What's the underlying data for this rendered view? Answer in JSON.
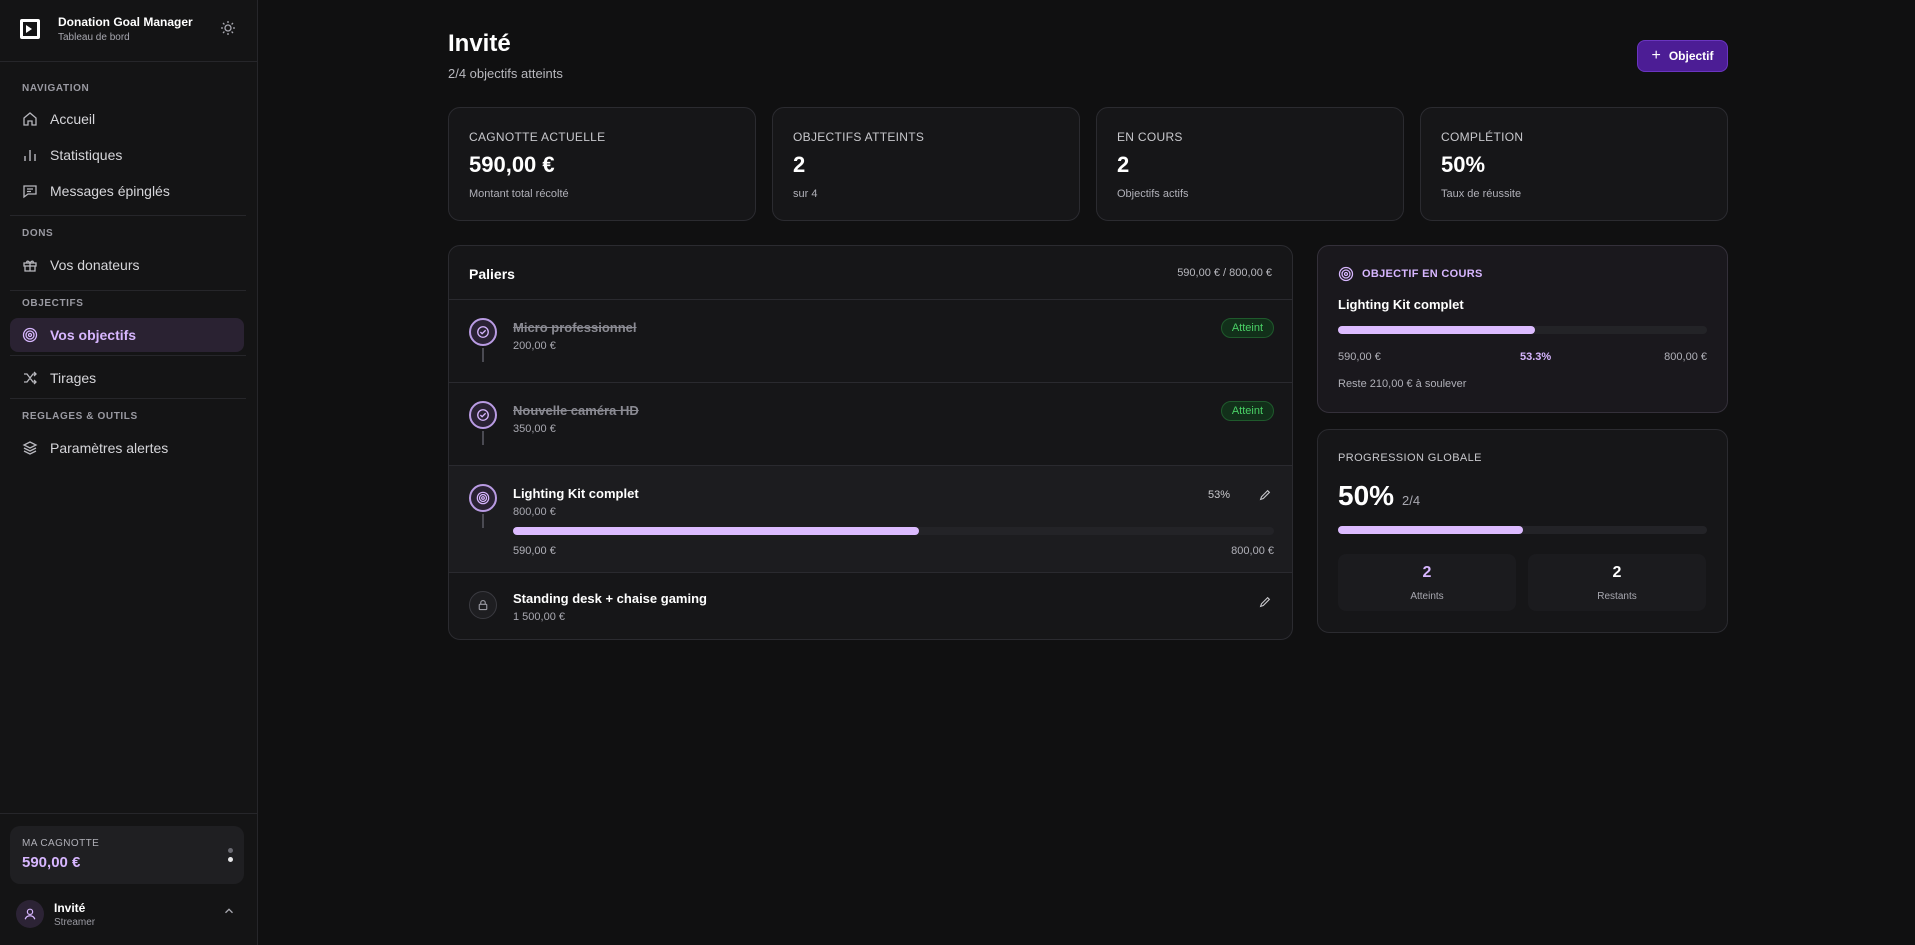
{
  "app": {
    "title": "Donation Goal Manager",
    "subtitle": "Tableau de bord"
  },
  "sidebar": {
    "sections": {
      "navigation": "NAVIGATION",
      "dons": "DONS",
      "objectifs": "OBJECTIFS",
      "reglages": "REGLAGES & OUTILS"
    },
    "items": [
      {
        "label": "Accueil",
        "icon": "home-icon"
      },
      {
        "label": "Statistiques",
        "icon": "bar-chart-icon"
      },
      {
        "label": "Messages épinglés",
        "icon": "message-icon"
      },
      {
        "label": "Vos donateurs",
        "icon": "gift-icon"
      },
      {
        "label": "Vos objectifs",
        "icon": "target-icon",
        "active": true
      },
      {
        "label": "Tirages",
        "icon": "shuffle-icon"
      },
      {
        "label": "Paramètres alertes",
        "icon": "layers-icon"
      }
    ],
    "wallet": {
      "label": "MA CAGNOTTE",
      "value": "590,00 €"
    },
    "user": {
      "name": "Invité",
      "role": "Streamer"
    }
  },
  "header": {
    "title": "Invité",
    "subtitle": "2/4 objectifs atteints",
    "add_button": "Objectif"
  },
  "stats": [
    {
      "label": "CAGNOTTE ACTUELLE",
      "value": "590,00 €",
      "sub": "Montant total récolté"
    },
    {
      "label": "OBJECTIFS ATTEINTS",
      "value": "2",
      "sub": "sur 4"
    },
    {
      "label": "EN COURS",
      "value": "2",
      "sub": "Objectifs actifs"
    },
    {
      "label": "COMPLÉTION",
      "value": "50%",
      "sub": "Taux de réussite"
    }
  ],
  "paliers": {
    "title": "Paliers",
    "total": "590,00 € / 800,00 €",
    "tiers": [
      {
        "name": "Micro professionnel",
        "amount": "200,00 €",
        "status": "Atteint"
      },
      {
        "name": "Nouvelle caméra HD",
        "amount": "350,00 €",
        "status": "Atteint"
      },
      {
        "name": "Lighting Kit complet",
        "amount": "800,00 €",
        "percent": "53%",
        "progress": 0.533,
        "from": "590,00 €",
        "to": "800,00 €"
      },
      {
        "name": "Standing desk + chaise gaming",
        "amount": "1 500,00 €"
      }
    ]
  },
  "current_goal": {
    "heading": "OBJECTIF EN COURS",
    "name": "Lighting Kit complet",
    "progress": 0.533,
    "left": "590,00 €",
    "percent": "53.3%",
    "right": "800,00 €",
    "remaining": "Reste 210,00 € à soulever"
  },
  "global": {
    "label": "PROGRESSION GLOBALE",
    "percent": "50%",
    "fraction": "2/4",
    "progress": 0.5,
    "reached_value": "2",
    "reached_label": "Atteints",
    "remaining_value": "2",
    "remaining_label": "Restants"
  },
  "colors": {
    "accent": "#d7b6ff",
    "button": "#4c1d95",
    "success": "#4ad066",
    "background": "#101011"
  }
}
